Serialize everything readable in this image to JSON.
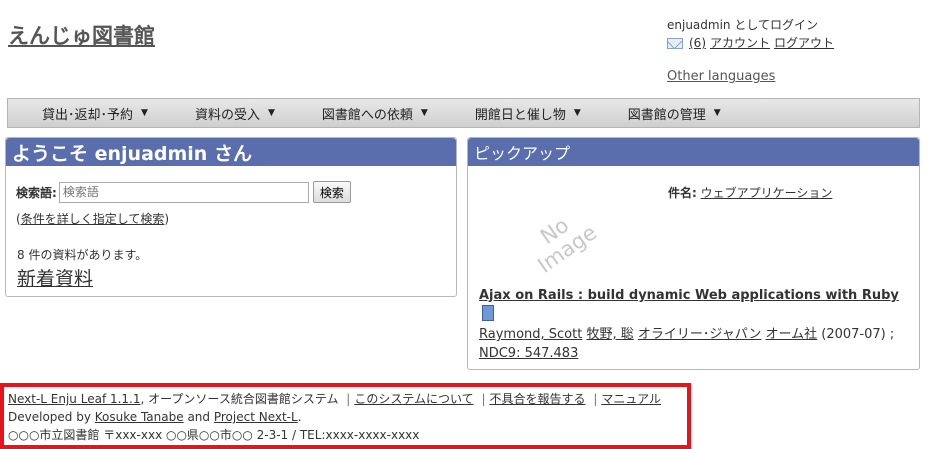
{
  "site": {
    "title": "えんじゅ図書館"
  },
  "user": {
    "login_text": "enjuadmin としてログイン",
    "message_count": "(6)",
    "account": "アカウント",
    "logout": "ログアウト",
    "other_languages": "Other languages"
  },
  "menu": [
    {
      "label": "貸出･返却･予約"
    },
    {
      "label": "資料の受入"
    },
    {
      "label": "図書館への依頼"
    },
    {
      "label": "開館日と催し物"
    },
    {
      "label": "図書館の管理"
    }
  ],
  "welcome": {
    "title": "ようこそ enjuadmin さん",
    "search_label": "検索語:",
    "search_placeholder": "検索語",
    "search_button": "検索",
    "paren_open": "(",
    "advanced": "条件を詳しく指定して検索",
    "paren_close": ")",
    "count_text": "8 件の資料があります。",
    "new_items": "新着資料"
  },
  "pickup": {
    "title": "ピックアップ",
    "subject_label": "件名:",
    "subject": "ウェブアプリケーション",
    "no_image_1": "No",
    "no_image_2": "Image",
    "book_title": "Ajax on Rails : build dynamic Web applications with Ruby",
    "creator1": "Raymond, Scott",
    "creator2": "牧野, 聡",
    "publisher1": "オライリー･ジャパン",
    "publisher2": "オーム社",
    "date": "(2007-07)",
    "sep": ";",
    "ndc": "NDC9: 547.483"
  },
  "footer": {
    "software": "Next-L Enju Leaf 1.1.1",
    "software_desc": ", オープンソース統合図書館システム",
    "about": "このシステムについて",
    "report": "不具合を報告する",
    "manual": "マニュアル",
    "dev_prefix": "Developed by",
    "dev1": "Kosuke Tanabe",
    "dev_and": "and",
    "dev2": "Project Next-L",
    "dev_end": ".",
    "address": "○○○市立図書館 〒xxx-xxx ○○県○○市○○ 2-3-1 / TEL:xxxx-xxxx-xxxx",
    "separator": "|"
  },
  "colors": {
    "panel_header": "#5a6ead",
    "footer_border": "#e6141b"
  }
}
